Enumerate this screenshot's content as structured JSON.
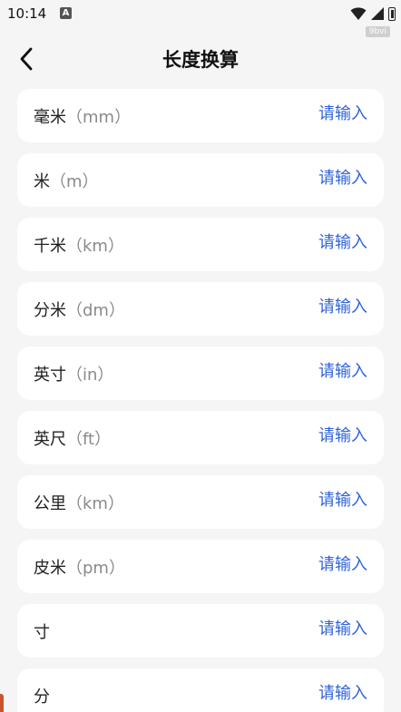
{
  "status_bar": {
    "time": "10:14",
    "notification_letter": "A",
    "icons": [
      "wifi-icon",
      "signal-icon",
      "battery-icon"
    ],
    "watermark": "9bvi"
  },
  "header": {
    "back_icon": "chevron-left-icon",
    "title": "长度换算"
  },
  "colors": {
    "accent_blue": "#2f63d8",
    "background": "#f5f5f5",
    "card": "#ffffff"
  },
  "units": [
    {
      "name": "毫米",
      "unit": "（mm）",
      "placeholder": "请输入"
    },
    {
      "name": "米",
      "unit": "（m）",
      "placeholder": "请输入"
    },
    {
      "name": "千米",
      "unit": "（km）",
      "placeholder": "请输入"
    },
    {
      "name": "分米",
      "unit": "（dm）",
      "placeholder": "请输入"
    },
    {
      "name": "英寸",
      "unit": "（in）",
      "placeholder": "请输入"
    },
    {
      "name": "英尺",
      "unit": "（ft）",
      "placeholder": "请输入"
    },
    {
      "name": "公里",
      "unit": "（km）",
      "placeholder": "请输入"
    },
    {
      "name": "皮米",
      "unit": "（pm）",
      "placeholder": "请输入"
    },
    {
      "name": "寸",
      "unit": "",
      "placeholder": "请输入"
    },
    {
      "name": "分",
      "unit": "",
      "placeholder": "请输入"
    }
  ]
}
